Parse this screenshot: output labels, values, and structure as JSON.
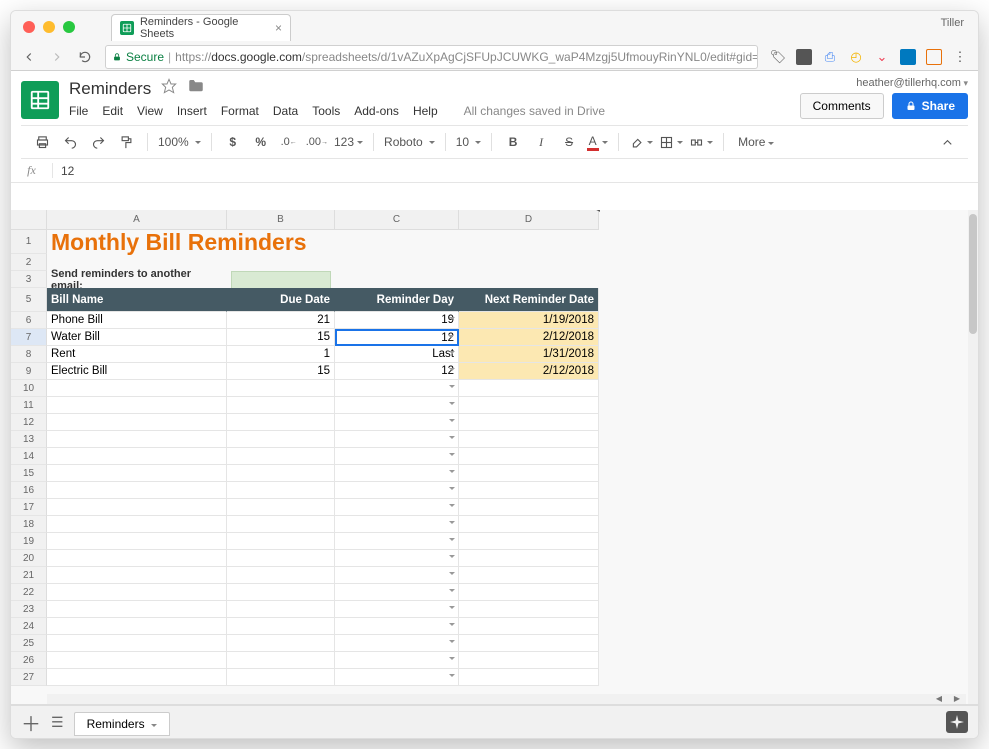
{
  "browser": {
    "tab_title": "Reminders - Google Sheets",
    "profile": "Tiller",
    "secure_label": "Secure",
    "url_prefix": "https://",
    "url_host": "docs.google.com",
    "url_path": "/spreadsheets/d/1vAZuXpAgCjSFUpJCUWKG_waP4Mzgj5UfmouyRinYNL0/edit#gid=..."
  },
  "docs": {
    "title": "Reminders",
    "menu": [
      "File",
      "Edit",
      "View",
      "Insert",
      "Format",
      "Data",
      "Tools",
      "Add-ons",
      "Help"
    ],
    "saved": "All changes saved in Drive",
    "user": "heather@tillerhq.com",
    "comments": "Comments",
    "share": "Share",
    "more": "More"
  },
  "toolbar": {
    "zoom": "100%",
    "format123": "123",
    "font": "Roboto",
    "fontsize": "10"
  },
  "formula": {
    "value": "12"
  },
  "sheet": {
    "columns": [
      "A",
      "B",
      "C",
      "D"
    ],
    "title": "Monthly Bill Reminders",
    "email_label": "Send reminders to another email:",
    "headers": {
      "a": "Bill Name",
      "b": "Due Date",
      "c": "Reminder Day",
      "d": "Next Reminder Date"
    },
    "rows": [
      {
        "n": 6,
        "a": "Phone Bill",
        "b": "21",
        "c": "19",
        "d": "1/19/2018"
      },
      {
        "n": 7,
        "a": "Water Bill",
        "b": "15",
        "c": "12",
        "d": "2/12/2018",
        "selected": true
      },
      {
        "n": 8,
        "a": "Rent",
        "b": "1",
        "c": "Last",
        "d": "1/31/2018"
      },
      {
        "n": 9,
        "a": "Electric Bill",
        "b": "15",
        "c": "12",
        "d": "2/12/2018"
      }
    ],
    "empty_rows": [
      10,
      11,
      12,
      13,
      14,
      15,
      16,
      17,
      18,
      19,
      20,
      21,
      22,
      23,
      24,
      25,
      26,
      27
    ],
    "tab": "Reminders"
  }
}
